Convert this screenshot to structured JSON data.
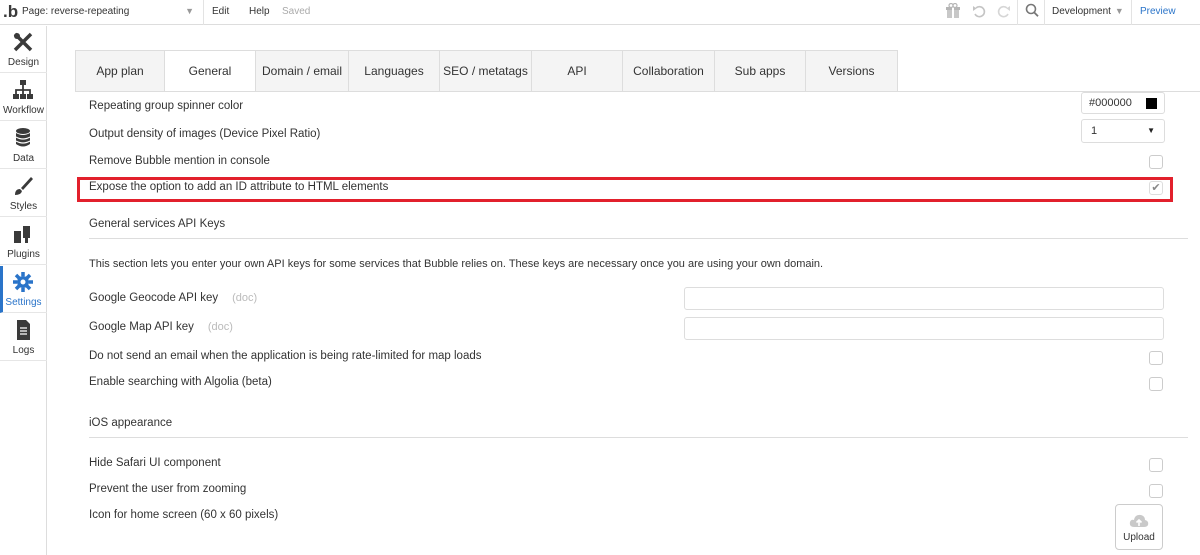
{
  "topbar": {
    "logo": ".b",
    "page_selector": "Page: reverse-repeating",
    "menu_edit": "Edit",
    "menu_help": "Help",
    "status": "Saved",
    "environment": "Development",
    "preview": "Preview"
  },
  "sidebar": {
    "items": [
      {
        "label": "Design",
        "icon": "design-icon"
      },
      {
        "label": "Workflow",
        "icon": "workflow-icon"
      },
      {
        "label": "Data",
        "icon": "database-icon"
      },
      {
        "label": "Styles",
        "icon": "brush-icon"
      },
      {
        "label": "Plugins",
        "icon": "plug-icon"
      },
      {
        "label": "Settings",
        "icon": "gear-icon"
      },
      {
        "label": "Logs",
        "icon": "document-icon"
      }
    ],
    "active": "Settings"
  },
  "tabs": [
    "App plan",
    "General",
    "Domain / email",
    "Languages",
    "SEO / metatags",
    "API",
    "Collaboration",
    "Sub apps",
    "Versions"
  ],
  "active_tab": "General",
  "settings": {
    "spinner_color_label": "Repeating group spinner color",
    "spinner_color_value": "#000000",
    "pixel_ratio_label": "Output density of images (Device Pixel Ratio)",
    "pixel_ratio_value": "1",
    "remove_mention_label": "Remove Bubble mention in console",
    "remove_mention_checked": false,
    "expose_id_label": "Expose the option to add an ID attribute to HTML elements",
    "expose_id_checked": true
  },
  "api_keys": {
    "title": "General services API Keys",
    "description": "This section lets you enter your own API keys for some services that Bubble relies on. These keys are necessary once you are using your own domain.",
    "geocode_label": "Google Geocode API key",
    "geocode_doc": "(doc)",
    "geocode_value": "",
    "map_label": "Google Map API key",
    "map_doc": "(doc)",
    "map_value": "",
    "rate_limit_label": "Do not send an email when the application is being rate-limited for map loads",
    "algolia_label": "Enable searching with Algolia (beta)"
  },
  "ios": {
    "title": "iOS appearance",
    "hide_safari_label": "Hide Safari UI component",
    "prevent_zoom_label": "Prevent the user from zooming",
    "home_icon_label": "Icon for home screen (60 x 60 pixels)",
    "upload_label": "Upload"
  },
  "colors": {
    "accent": "#2a74c9",
    "highlight": "#e2202c"
  }
}
